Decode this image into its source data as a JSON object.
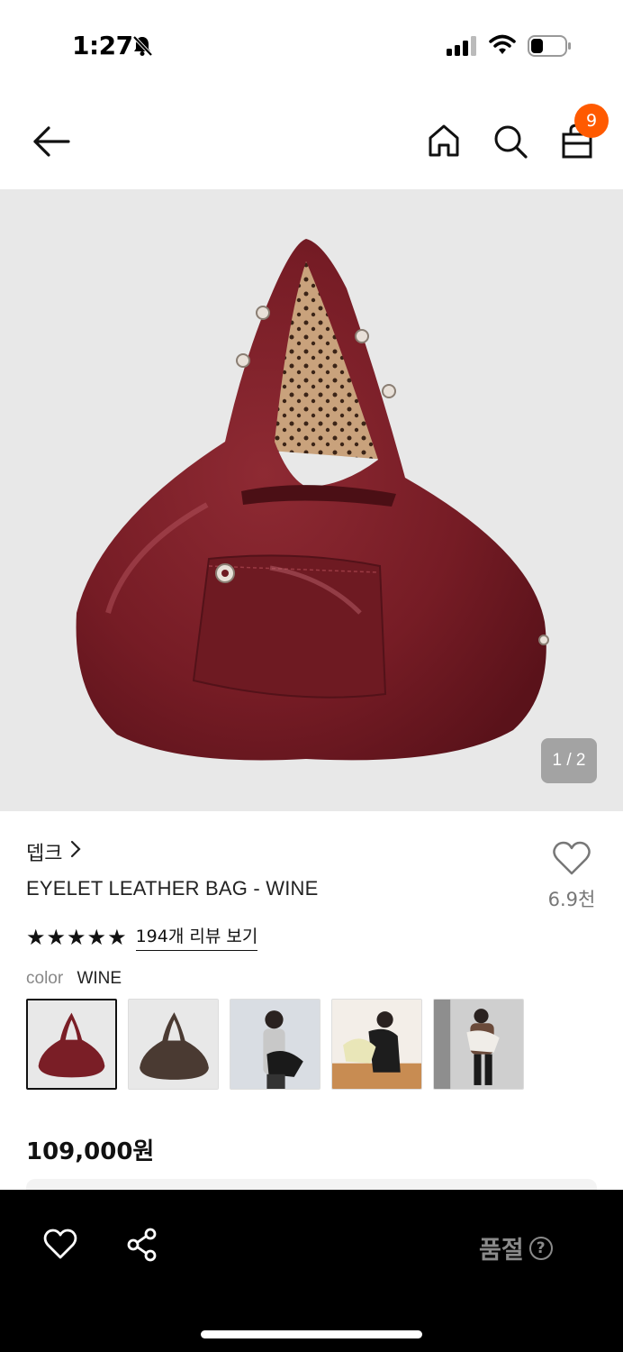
{
  "status": {
    "time": "1:27"
  },
  "nav": {
    "cart_count": "9"
  },
  "gallery": {
    "counter": "1 / 2"
  },
  "product": {
    "brand": "뎁크",
    "title": "EYELET LEATHER BAG - WINE",
    "like_count": "6.9천",
    "rating_stars": 5,
    "review_link": "194개 리뷰 보기",
    "color_label": "color",
    "color_value": "WINE",
    "price": "109,000원"
  },
  "bottom": {
    "soldout_label": "품절"
  },
  "colors": {
    "accent": "#ff5a00",
    "wine": "#7a1e26"
  }
}
